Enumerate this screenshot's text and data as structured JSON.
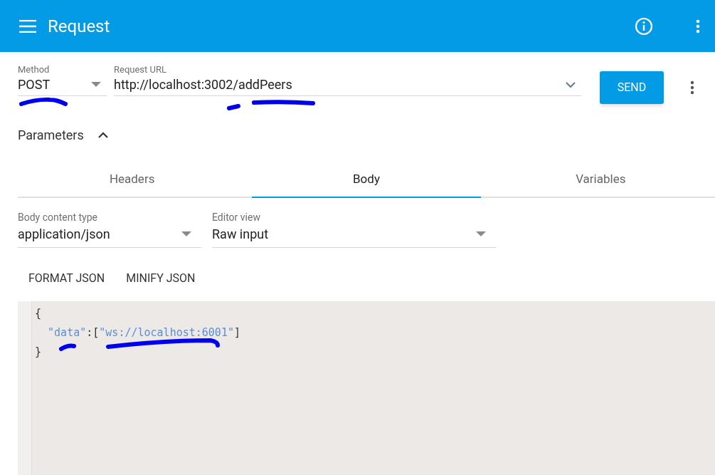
{
  "app_bar": {
    "title": "Request"
  },
  "request": {
    "method": {
      "label": "Method",
      "value": "POST"
    },
    "url": {
      "label": "Request URL",
      "value": "http://localhost:3002/addPeers"
    },
    "send_label": "SEND"
  },
  "parameters": {
    "label": "Parameters",
    "expanded": true
  },
  "tabs": [
    {
      "label": "Headers",
      "selected": false
    },
    {
      "label": "Body",
      "selected": true
    },
    {
      "label": "Variables",
      "selected": false
    }
  ],
  "body_fields": [
    {
      "label": "Body content type",
      "value": "application/json"
    },
    {
      "label": "Editor view",
      "value": "Raw input"
    }
  ],
  "actions": [
    "FORMAT JSON",
    "MINIFY JSON"
  ],
  "editor": {
    "lines": [
      [
        {
          "kind": "punct",
          "text": "{"
        }
      ],
      [
        {
          "kind": "string",
          "text": "  \"data\""
        },
        {
          "kind": "punct",
          "text": ":["
        },
        {
          "kind": "string",
          "text": "\"ws://localhost:6001\""
        },
        {
          "kind": "punct",
          "text": "]"
        }
      ],
      [
        {
          "kind": "punct",
          "text": "}"
        }
      ]
    ]
  }
}
